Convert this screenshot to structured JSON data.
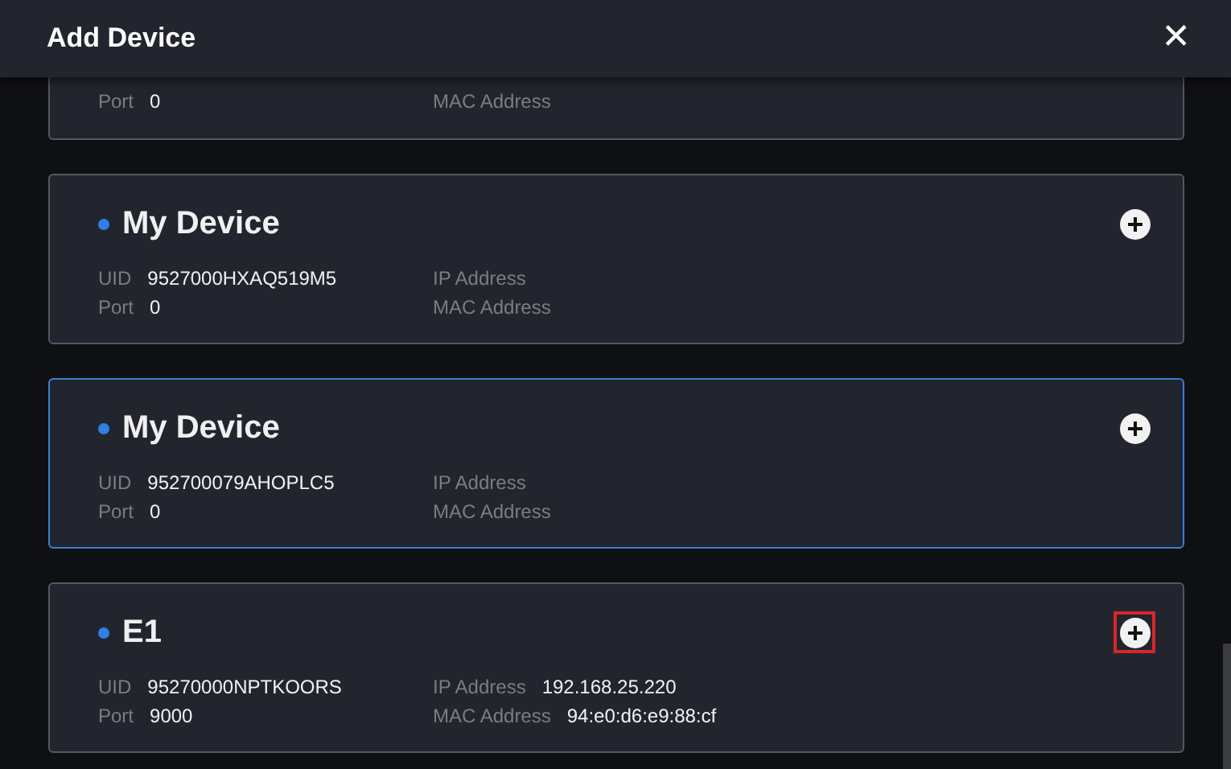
{
  "window": {
    "title": "Add Device",
    "close": "✕"
  },
  "devices": [
    {
      "kind": "partial",
      "selected": false,
      "left": [
        {
          "label": "Port",
          "value": "0"
        }
      ],
      "right": [
        {
          "label": "MAC Address"
        }
      ]
    },
    {
      "kind": "full",
      "name": "My Device",
      "selected": false,
      "highlighted": false,
      "left": [
        {
          "label": "UID",
          "value": "9527000HXAQ519M5"
        },
        {
          "label": "Port",
          "value": "0"
        }
      ],
      "right": [
        {
          "label": "IP Address"
        },
        {
          "label": "MAC Address"
        }
      ]
    },
    {
      "kind": "full",
      "name": "My Device",
      "selected": true,
      "highlighted": false,
      "left": [
        {
          "label": "UID",
          "value": "952700079AHOPLC5"
        },
        {
          "label": "Port",
          "value": "0"
        }
      ],
      "right": [
        {
          "label": "IP Address"
        },
        {
          "label": "MAC Address"
        }
      ]
    },
    {
      "kind": "full",
      "name": "E1",
      "selected": false,
      "highlighted": true,
      "left": [
        {
          "label": "UID",
          "value": "95270000NPTKOORS"
        },
        {
          "label": "Port",
          "value": "9000"
        }
      ],
      "right": [
        {
          "label": "IP Address",
          "value": "192.168.25.220"
        },
        {
          "label": "MAC Address",
          "value": "94:e0:d6:e9:88:cf"
        }
      ]
    }
  ]
}
